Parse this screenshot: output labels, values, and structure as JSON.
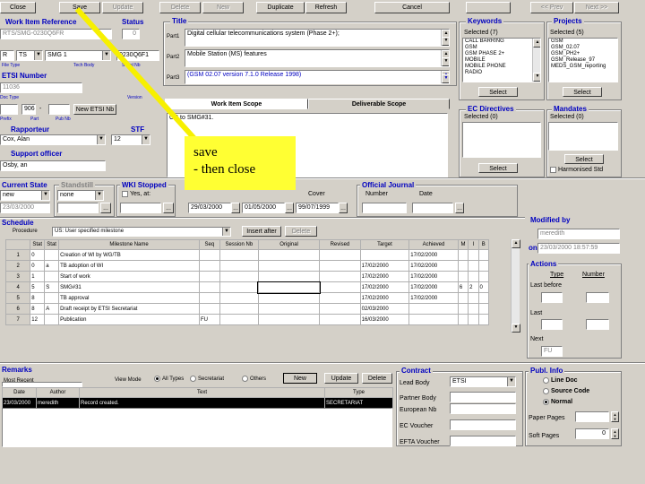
{
  "toolbar": {
    "close": "Close",
    "save": "Save",
    "update": "Update",
    "delete": "Delete",
    "new": "New",
    "duplicate": "Duplicate",
    "refresh": "Refresh",
    "cancel": "Cancel",
    "extra": "",
    "prev": "<< Prev",
    "next": "Next >>"
  },
  "wi_ref": {
    "label": "Work Item Reference",
    "value": "RTS/SMG-0230Q6FR",
    "c1": "R",
    "c2": "TS",
    "c3": "SMG 1",
    "c4": "0230Q6F1",
    "s1": "File Type",
    "s2": "Tech Body",
    "s3": "Serial Nb"
  },
  "status": {
    "label": "Status",
    "value": "0"
  },
  "etsi": {
    "label": "ETSI Number",
    "value": "11036",
    "type_label": "Doc Type",
    "ver_label": "Version",
    "prefix": "",
    "num": "906",
    "dash": "-",
    "btn": "New ETSI Nb",
    "pref_label": "Prefix",
    "part_label": "Part",
    "pub_label": "Pub Nb"
  },
  "rapporteur": {
    "label": "Rapporteur",
    "value": "Cox, Alan",
    "stf_label": "STF",
    "stf_value": "12"
  },
  "support": {
    "label": "Support officer",
    "value": "Osby, an"
  },
  "title": {
    "label": "Title",
    "p1_label": "Part1",
    "p1": "Digital cellular telecommunications system (Phase 2+);",
    "p2_label": "Part2",
    "p2": "Mobile Station (MS) features",
    "p3_label": "Part3",
    "p3": "(GSM 02.07 version 7.1.0 Release 1998)"
  },
  "scope_tabs": {
    "t1": "Work Item Scope",
    "t2": "Deliverable Scope",
    "text": "CR to SMG#31."
  },
  "annotation": {
    "line1": "save",
    "line2": "- then close"
  },
  "keywords": {
    "label": "Keywords",
    "selected": "Selected (7)",
    "items": [
      "CALL BARRING",
      "GSM",
      "GSM PHASE 2+",
      "MOBILE",
      "MOBILE PHONE",
      "RADIO"
    ],
    "btn": "Select"
  },
  "projects": {
    "label": "Projects",
    "selected": "Selected (5)",
    "items": [
      "GSM",
      "GSM_02.07",
      "GSM_PH2+",
      "GSM_Release_97",
      "MEDS_GSM_reporting"
    ],
    "btn": "Select"
  },
  "ec_directives": {
    "label": "EC Directives",
    "selected": "Selected (0)",
    "btn": "Select"
  },
  "mandates": {
    "label": "Mandates",
    "selected": "Selected (0)",
    "btn": "Select",
    "harm": "Harmonised Std"
  },
  "current_state": {
    "label": "Current State",
    "value": "new",
    "date": "23/03/2000"
  },
  "standstill": {
    "label": "Standstill",
    "value": "none"
  },
  "wki": {
    "label": "WKI Stopped",
    "yes": "Yes, at:"
  },
  "dates": {
    "d1": "29/03/2000",
    "d2": "01/05/2000",
    "cover_label": "Cover",
    "cover": "99/07/1999"
  },
  "oj": {
    "label": "Official Journal",
    "number": "Number",
    "date": "Date"
  },
  "modified": {
    "label": "Modified by",
    "by": "meredith",
    "on_label": "on",
    "on": "23/03/2000 18:57:59"
  },
  "schedule": {
    "label": "Schedule",
    "proc_label": "Procedure",
    "proc_value": "US: User specified milestone",
    "insert": "Insert after",
    "delete": "Delete",
    "headers": [
      "",
      "Stat",
      "Stat",
      "Milestone Name",
      "Seq",
      "Session Nb",
      "Original",
      "Revised",
      "Target",
      "Achieved",
      "M",
      "I",
      "B"
    ],
    "rows": [
      [
        "1",
        "0",
        "",
        "Creation of WI by WG/TB",
        "",
        "",
        "",
        "",
        "",
        "17/02/2000",
        "",
        "",
        ""
      ],
      [
        "2",
        "0",
        "a",
        "TB adoption of WI",
        "",
        "",
        "",
        "",
        "17/02/2000",
        "17/02/2000",
        "",
        "",
        ""
      ],
      [
        "3",
        "1",
        "",
        "Start of work",
        "",
        "",
        "",
        "",
        "17/02/2000",
        "17/02/2000",
        "",
        "",
        ""
      ],
      [
        "4",
        "5",
        "S",
        "SMG#31",
        "",
        "",
        "",
        "",
        "17/02/2000",
        "17/02/2000",
        "6",
        "2",
        "0"
      ],
      [
        "5",
        "8",
        "",
        "TB approval",
        "",
        "",
        "",
        "",
        "17/02/2000",
        "17/02/2000",
        "",
        "",
        ""
      ],
      [
        "6",
        "8",
        "A",
        "Draft receipt by ETSI Secretariat",
        "",
        "",
        "",
        "",
        "02/03/2000",
        "",
        "",
        "",
        ""
      ],
      [
        "7",
        "12",
        "",
        "Publication",
        "FU",
        "",
        "",
        "",
        "16/03/2000",
        "",
        "",
        "",
        ""
      ]
    ]
  },
  "actions": {
    "label": "Actions",
    "type": "Type",
    "number": "Number",
    "last_before": "Last before",
    "last": "Last",
    "next": "Next",
    "fu": "FU"
  },
  "remarks": {
    "label": "Remarks",
    "most": "Most Recent",
    "view": "View Mode",
    "all": "All Types",
    "secr": "Secretariat",
    "others": "Others",
    "new_btn": "New",
    "update": "Update",
    "delete": "Delete",
    "h_date": "Date",
    "h_author": "Author",
    "h_text": "Text",
    "h_type": "Type",
    "row": {
      "date": "23/03/2000",
      "author": "meredith",
      "text": "Record created.",
      "type": "SECRETARIAT"
    }
  },
  "contract": {
    "label": "Contract",
    "lead_label": "Lead Body",
    "lead": "ETSI",
    "partner": "Partner Body",
    "eu": "European Nb",
    "ec": "EC Voucher",
    "efta": "EFTA Voucher"
  },
  "publ": {
    "label": "Publ. Info",
    "o1": "Line Doc",
    "o2": "Source Code",
    "o3": "Normal",
    "pages": "Paper Pages",
    "soft": "Soft Pages",
    "soft_val": "0"
  }
}
